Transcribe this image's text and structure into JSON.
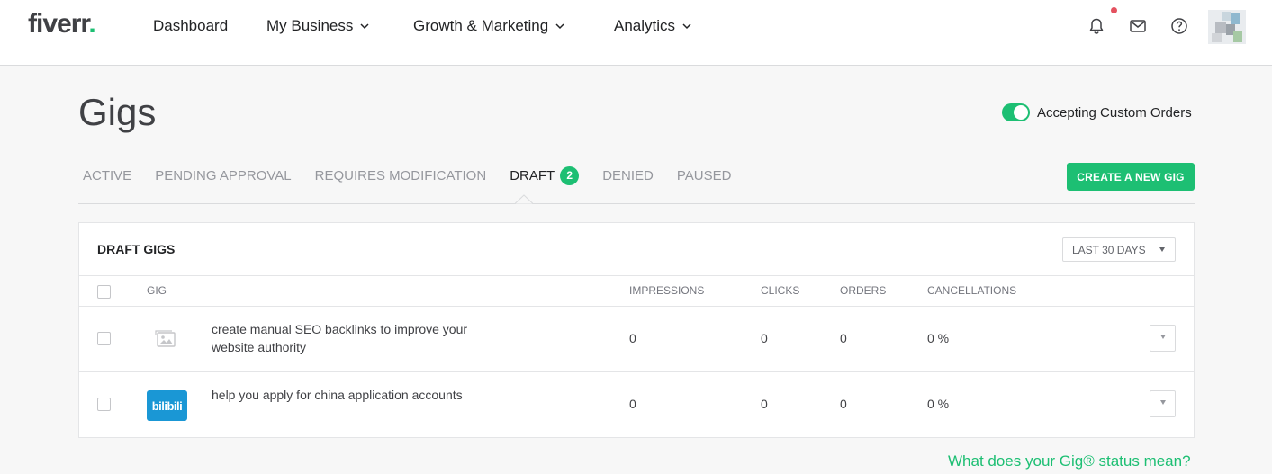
{
  "header": {
    "logo_text": "fiverr",
    "logo_dot": ".",
    "nav": [
      {
        "label": "Dashboard",
        "has_dropdown": false
      },
      {
        "label": "My Business",
        "has_dropdown": true
      },
      {
        "label": "Growth & Marketing",
        "has_dropdown": true
      },
      {
        "label": "Analytics",
        "has_dropdown": true
      }
    ],
    "icons": [
      "bell-icon",
      "envelope-icon",
      "help-icon"
    ],
    "has_notification": true
  },
  "page": {
    "title": "Gigs",
    "custom_orders_label": "Accepting Custom Orders",
    "custom_orders_enabled": true,
    "tabs": [
      {
        "label": "ACTIVE",
        "active": false
      },
      {
        "label": "PENDING APPROVAL",
        "active": false
      },
      {
        "label": "REQUIRES MODIFICATION",
        "active": false
      },
      {
        "label": "DRAFT",
        "active": true,
        "count": "2"
      },
      {
        "label": "DENIED",
        "active": false
      },
      {
        "label": "PAUSED",
        "active": false
      }
    ],
    "create_button": "CREATE A NEW GIG"
  },
  "panel": {
    "title": "DRAFT GIGS",
    "range": "LAST 30 DAYS",
    "columns": {
      "gig": "GIG",
      "impressions": "IMPRESSIONS",
      "clicks": "CLICKS",
      "orders": "ORDERS",
      "cancellations": "CANCELLATIONS"
    },
    "rows": [
      {
        "title": "create manual SEO backlinks to improve your website authority",
        "thumbnail": "image-placeholder-icon",
        "impressions": "0",
        "clicks": "0",
        "orders": "0",
        "cancellations": "0 %"
      },
      {
        "title": "help you apply for china application accounts",
        "thumbnail": "bilibili",
        "thumbnail_text": "bilibili",
        "impressions": "0",
        "clicks": "0",
        "orders": "0",
        "cancellations": "0 %"
      }
    ]
  },
  "footer": {
    "status_link": "What does your Gig® status mean?"
  },
  "colors": {
    "accent": "#1dbf73",
    "notification": "#e4515f",
    "bilibili_blue": "#1a97d5"
  }
}
